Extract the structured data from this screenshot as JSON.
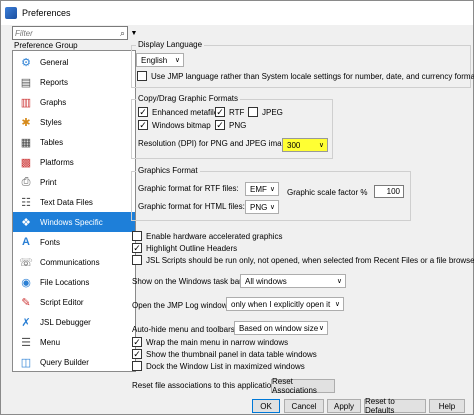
{
  "window": {
    "title": "Preferences"
  },
  "filter": {
    "placeholder": "Filter"
  },
  "sidebar": {
    "group_label": "Preference Group",
    "items": [
      {
        "label": "General",
        "icon": "general-icon"
      },
      {
        "label": "Reports",
        "icon": "reports-icon"
      },
      {
        "label": "Graphs",
        "icon": "graphs-icon"
      },
      {
        "label": "Styles",
        "icon": "styles-icon"
      },
      {
        "label": "Tables",
        "icon": "tables-icon"
      },
      {
        "label": "Platforms",
        "icon": "platforms-icon"
      },
      {
        "label": "Print",
        "icon": "print-icon"
      },
      {
        "label": "Text Data Files",
        "icon": "text-data-files-icon"
      },
      {
        "label": "Windows Specific",
        "icon": "windows-icon"
      },
      {
        "label": "Fonts",
        "icon": "fonts-icon"
      },
      {
        "label": "Communications",
        "icon": "communications-icon"
      },
      {
        "label": "File Locations",
        "icon": "file-locations-icon"
      },
      {
        "label": "Script Editor",
        "icon": "script-editor-icon"
      },
      {
        "label": "JSL Debugger",
        "icon": "jsl-debugger-icon"
      },
      {
        "label": "Menu",
        "icon": "menu-icon"
      },
      {
        "label": "Query Builder",
        "icon": "query-builder-icon"
      }
    ],
    "selected": "Windows Specific"
  },
  "display_language": {
    "title": "Display Language",
    "value": "English",
    "use_jmp_language": {
      "label": "Use JMP language rather than System locale settings for number, date, and currency formats",
      "checked": false
    }
  },
  "copy_drag": {
    "title": "Copy/Drag Graphic Formats",
    "enhanced_metafile": {
      "label": "Enhanced metafile",
      "checked": true
    },
    "rtf": {
      "label": "RTF",
      "checked": true
    },
    "jpeg": {
      "label": "JPEG",
      "checked": false
    },
    "windows_bitmap": {
      "label": "Windows bitmap",
      "checked": true
    },
    "png": {
      "label": "PNG",
      "checked": true
    },
    "resolution_label": "Resolution (DPI) for PNG and JPEG images:",
    "resolution_value": "300"
  },
  "graphics_format": {
    "title": "Graphics Format",
    "rtf_label": "Graphic format for RTF files:",
    "rtf_value": "EMF",
    "html_label": "Graphic format for HTML files:",
    "html_value": "PNG",
    "scale_label": "Graphic scale factor %",
    "scale_value": "100"
  },
  "options": {
    "hardware_accel": {
      "label": "Enable hardware accelerated graphics",
      "checked": false
    },
    "highlight_outline": {
      "label": "Highlight Outline Headers",
      "checked": true
    },
    "jsl_scripts": {
      "label": "JSL Scripts should be run only, not opened, when selected from Recent Files or a file browser",
      "checked": false
    }
  },
  "taskbar": {
    "label": "Show on the Windows task bar:",
    "value": "All windows"
  },
  "log_window": {
    "label": "Open the JMP Log window",
    "value": "only when I explicitly open it"
  },
  "autohide": {
    "label": "Auto-hide menu and toolbars",
    "value": "Based on window size"
  },
  "windows_options": {
    "wrap_menu": {
      "label": "Wrap the main menu in narrow windows",
      "checked": true
    },
    "thumbnail": {
      "label": "Show the thumbnail panel in data table windows",
      "checked": true
    },
    "dock_list": {
      "label": "Dock the Window List in maximized windows",
      "checked": false
    }
  },
  "reset_assoc": {
    "label": "Reset file associations to this application:",
    "button": "Reset Associations"
  },
  "footer": {
    "ok": "OK",
    "cancel": "Cancel",
    "apply": "Apply",
    "reset_defaults": "Reset to Defaults",
    "help": "Help"
  }
}
